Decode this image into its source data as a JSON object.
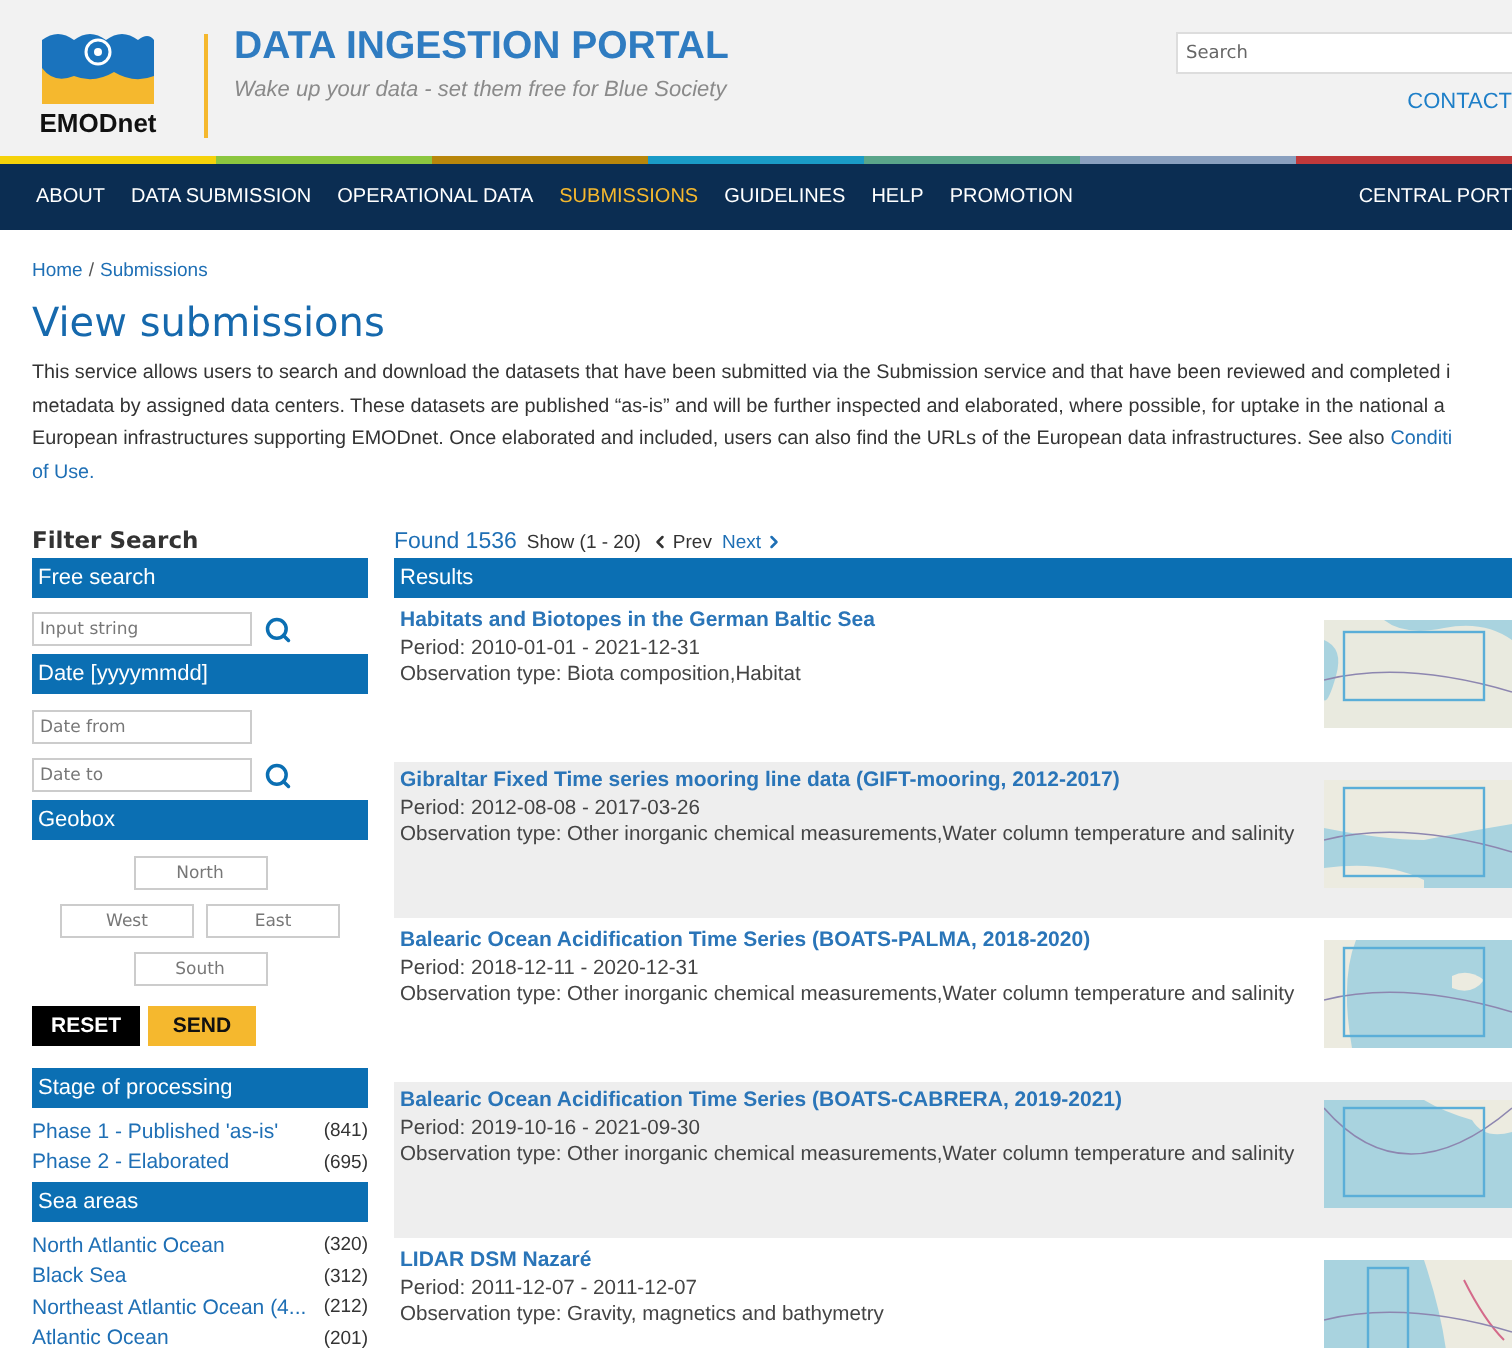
{
  "header": {
    "logo_text": "EMODnet",
    "title": "DATA INGESTION PORTAL",
    "subtitle": "Wake up your data - set them free for Blue Society",
    "search_placeholder": "Search",
    "contact": "CONTACT"
  },
  "nav": {
    "items": [
      {
        "label": "ABOUT",
        "selected": false
      },
      {
        "label": "DATA SUBMISSION",
        "selected": false
      },
      {
        "label": "OPERATIONAL DATA",
        "selected": false
      },
      {
        "label": "SUBMISSIONS",
        "selected": true
      },
      {
        "label": "GUIDELINES",
        "selected": false
      },
      {
        "label": "HELP",
        "selected": false
      },
      {
        "label": "PROMOTION",
        "selected": false
      }
    ],
    "right_item": "CENTRAL PORT"
  },
  "breadcrumb": {
    "items": [
      "Home",
      "Submissions"
    ],
    "separator": "/"
  },
  "page_title": "View submissions",
  "description": [
    {
      "text": "This service allows users to search and download the datasets that have been submitted via the Submission service and that have been reviewed and completed i"
    },
    {
      "text": "metadata by assigned data centers. These datasets are published “as-is” and will be further inspected and elaborated, where possible, for uptake in the national a"
    },
    {
      "text": "European infrastructures supporting EMODnet. Once elaborated and included, users can also find the URLs of the European data infrastructures. See also",
      "link": "Conditi"
    },
    {
      "link": "of Use."
    }
  ],
  "sidebar": {
    "title": "Filter Search",
    "free_search": {
      "header": "Free search",
      "placeholder": "Input string"
    },
    "date": {
      "header": "Date [yyyymmdd]",
      "from_placeholder": "Date from",
      "to_placeholder": "Date to"
    },
    "geobox": {
      "header": "Geobox",
      "north_placeholder": "North",
      "west_placeholder": "West",
      "east_placeholder": "East",
      "south_placeholder": "South"
    },
    "reset": "RESET",
    "send": "SEND",
    "facets": [
      {
        "header": "Stage of processing",
        "items": [
          {
            "label": "Phase 1 - Published 'as-is'",
            "count": "(841)"
          },
          {
            "label": "Phase 2 - Elaborated",
            "count": "(695)"
          }
        ]
      },
      {
        "header": "Sea areas",
        "items": [
          {
            "label": "North Atlantic Ocean",
            "count": "(320)"
          },
          {
            "label": "Black Sea",
            "count": "(312)"
          },
          {
            "label": "Northeast Atlantic Ocean (4...",
            "count": "(212)"
          },
          {
            "label": "Atlantic Ocean",
            "count": "(201)"
          }
        ]
      }
    ]
  },
  "results": {
    "found": "Found 1536",
    "show": "Show (1 - 20)",
    "prev": {
      "label": "Prev",
      "disabled": true
    },
    "next": {
      "label": "Next",
      "disabled": false
    },
    "header": "Results",
    "items": [
      {
        "title": "Habitats and Biotopes in the German Baltic Sea",
        "period": "Period: 2010-01-01 - 2021-12-31",
        "observation": "Observation type: Biota composition,Habitat"
      },
      {
        "title": "Gibraltar Fixed Time series mooring line data (GIFT-mooring, 2012-2017)",
        "period": "Period: 2012-08-08 - 2017-03-26",
        "observation": "Observation type: Other inorganic chemical measurements,Water column temperature and salinity"
      },
      {
        "title": "Balearic Ocean Acidification Time Series (BOATS-PALMA, 2018-2020)",
        "period": "Period: 2018-12-11 - 2020-12-31",
        "observation": "Observation type: Other inorganic chemical measurements,Water column temperature and salinity"
      },
      {
        "title": "Balearic Ocean Acidification Time Series (BOATS-CABRERA, 2019-2021)",
        "period": "Period: 2019-10-16 - 2021-09-30",
        "observation": "Observation type: Other inorganic chemical measurements,Water column temperature and salinity"
      },
      {
        "title": "LIDAR DSM Nazaré",
        "period": "Period: 2011-12-07 - 2011-12-07",
        "observation": "Observation type: Gravity, magnetics and bathymetry"
      }
    ]
  }
}
